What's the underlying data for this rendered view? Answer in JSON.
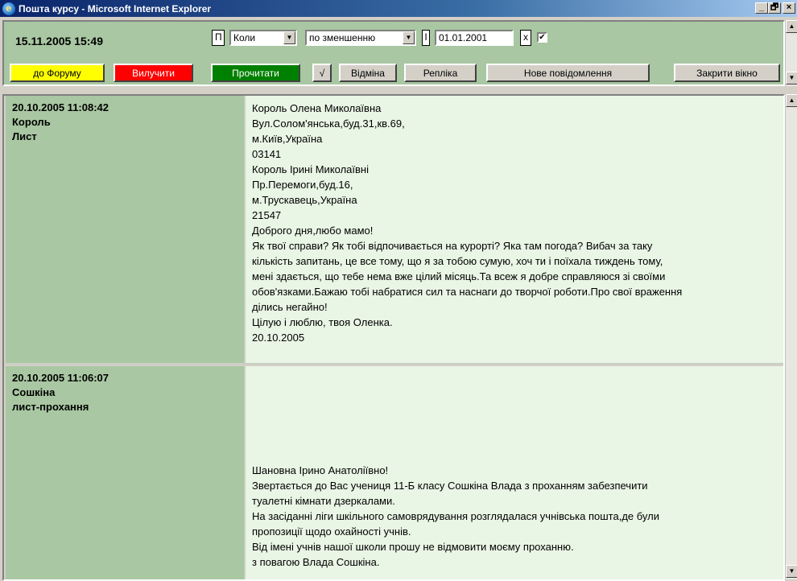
{
  "window": {
    "title": "Пошта курсу - Microsoft Internet Explorer",
    "minimize": "_",
    "maximize": "🗗",
    "close": "×"
  },
  "toolbar": {
    "datetime": "15.11.2005 15:49",
    "p_button": "П",
    "sort_field": "Коли",
    "sort_order": "по зменшенню",
    "i_button": "І",
    "date_from": "01.01.2001",
    "x_button": "х",
    "filter_checked": true,
    "forum_button": "до Форуму",
    "delete_button": "Вилучити",
    "read_button": "Прочитати",
    "check_button": "√",
    "cancel_button": "Відміна",
    "reply_button": "Репліка",
    "new_message_button": "Нове повідомлення",
    "close_window_button": "Закрити вікно"
  },
  "messages": [
    {
      "date": "20.10.2005 11:08:42",
      "author": "Король",
      "subject": "Лист",
      "lines": [
        "Король Олена Миколаївна",
        "Вул.Солом'янська,буд.31,кв.69,",
        "м.Київ,Україна",
        "03141",
        "Король Ірині Миколаївні",
        "Пр.Перемоги,буд.16,",
        "м.Трускавець,Україна",
        "21547",
        "Доброго дня,любо мамо!",
        "Як твої справи? Як тобі відпочивається на курорті? Яка там погода? Вибач за таку",
        "кількість запитань, це все тому, що я за тобою сумую, хоч ти і поїхала тиждень тому,",
        "мені здається, що тебе нема вже цілий місяць.Та всеж я добре справляюся зі своїми",
        "обов'язками.Бажаю тобі набратися сил та наснаги до творчої роботи.Про свої враження",
        "ділись негайно!",
        "Цілую і люблю, твоя Оленка.",
        "20.10.2005"
      ]
    },
    {
      "date": "20.10.2005 11:06:07",
      "author": "Сошкіна",
      "subject": "лист-прохання",
      "lines": [
        "Шановна Ірино Анатоліївно!",
        "Звертається до Вас учениця 11-Б класу Сошкіна Влада з проханням забезпечити",
        "туалетні кімнати дзеркалами.",
        "На засіданні ліги шкільного самоврядування розглядалася учнівська пошта,де були",
        "пропозиції щодо охайності учнів.",
        "Від імені учнів нашої школи прошу не відмовити моєму проханню.",
        "з повагою Влада Сошкіна."
      ]
    }
  ],
  "colors": {
    "forum_button_bg": "#ffff00",
    "delete_button_bg": "#ff0000",
    "read_button_bg": "#008000",
    "meta_bg": "#a9c7a2",
    "body_bg": "#e9f5e5"
  }
}
